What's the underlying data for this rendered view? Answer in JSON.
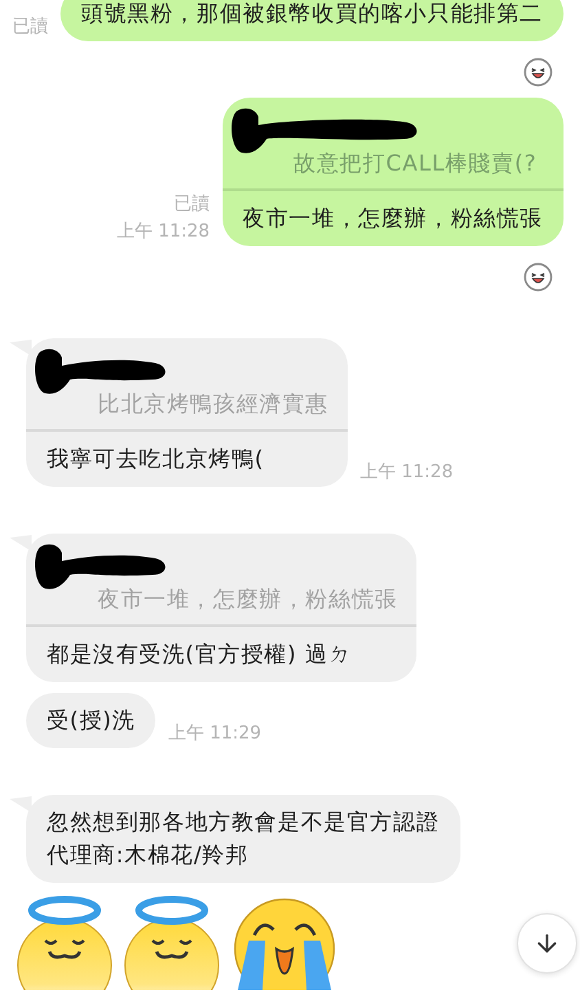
{
  "messages": [
    {
      "kind": "text",
      "outgoing": true,
      "tail": false,
      "read_label": "已讀",
      "lines": [
        "頭號黑粉，那個被銀幣收買的喀小只能排第二"
      ],
      "reaction": true
    },
    {
      "kind": "reply",
      "outgoing": true,
      "tail": false,
      "read_label": "已讀",
      "time": "上午 11:28",
      "quote": "故意把打CALL棒賤賣(?",
      "text": "夜市一堆，怎麼辦，粉絲慌張",
      "reaction": true
    },
    {
      "kind": "reply",
      "outgoing": false,
      "tail": true,
      "quote": "比北京烤鴨孩經濟實惠",
      "text": "我寧可去吃北京烤鴨(",
      "time": "上午 11:28"
    },
    {
      "kind": "reply",
      "outgoing": false,
      "tail": true,
      "quote": "夜市一堆，怎麼辦，粉絲慌張",
      "text": "都是沒有受洗(官方授權) 過ㄉ"
    },
    {
      "kind": "text",
      "outgoing": false,
      "tail": false,
      "lines": [
        "受(授)洗"
      ],
      "time": "上午 11:29"
    },
    {
      "kind": "text",
      "outgoing": false,
      "tail": true,
      "lines": [
        "忽然想到那各地方教會是不是官方認證",
        "代理商:木棉花/羚邦"
      ]
    },
    {
      "kind": "stickers",
      "outgoing": false,
      "stickers": [
        {
          "kind": "halo"
        },
        {
          "kind": "halo"
        },
        {
          "kind": "crying"
        }
      ]
    }
  ]
}
